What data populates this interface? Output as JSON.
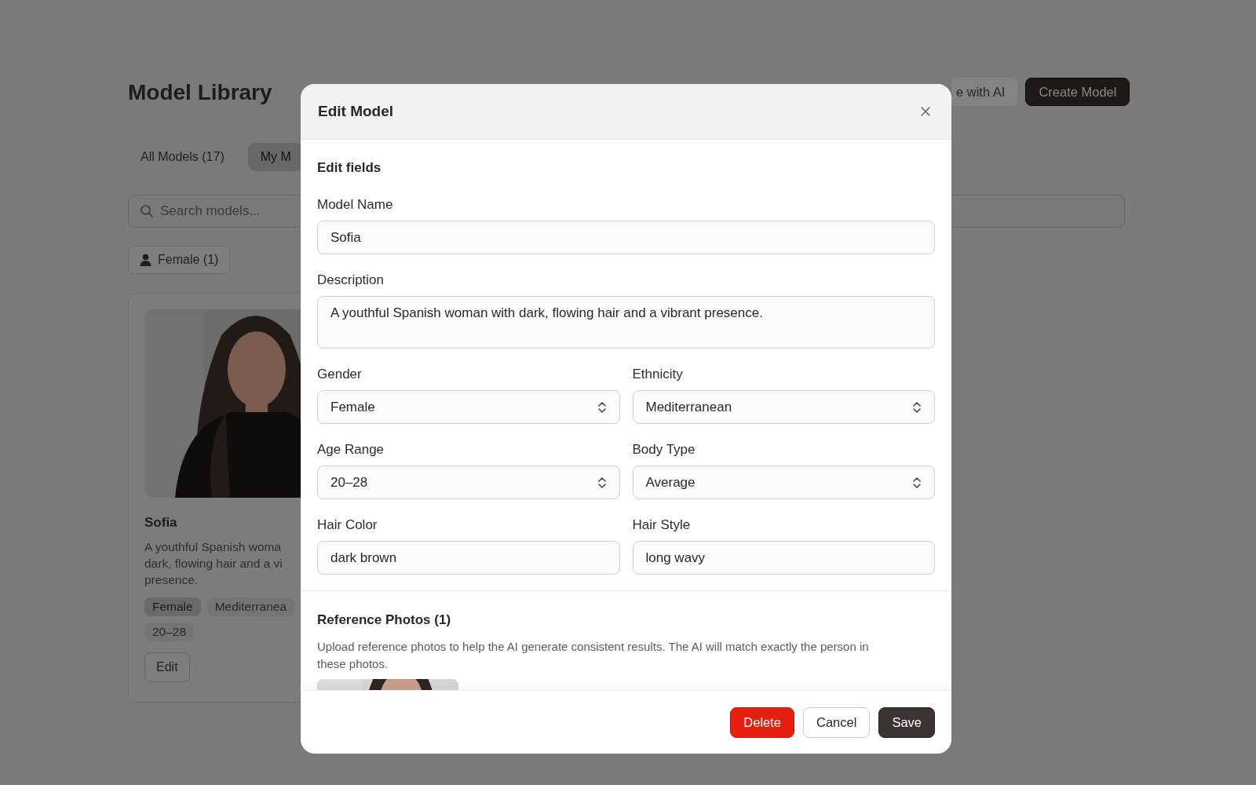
{
  "page": {
    "title": "Model Library",
    "header_buttons": [
      {
        "label": "e with AI",
        "kind": "secondary"
      },
      {
        "label": "Create Model",
        "kind": "primary"
      }
    ],
    "tabs": [
      {
        "label": "All Models (17)",
        "selected": false
      },
      {
        "label": "My M",
        "selected": true
      }
    ],
    "search": {
      "placeholder": "Search models..."
    },
    "filters": [
      {
        "label": "Female (1)"
      }
    ],
    "cards": [
      {
        "name": "Sofia",
        "description_lines": [
          "A youthful Spanish woma",
          "dark, flowing hair and a vi",
          "presence."
        ],
        "tags": [
          {
            "label": "Female",
            "selected": true
          },
          {
            "label": "Mediterranea",
            "selected": false
          },
          {
            "label": "20–28",
            "selected": false
          }
        ],
        "edit_button": "Edit"
      }
    ]
  },
  "modal": {
    "title": "Edit Model",
    "section": "Edit fields",
    "rows": [
      [
        {
          "label": "Model Name",
          "kind": "text",
          "value": "Sofia"
        }
      ],
      [
        {
          "label": "Description",
          "kind": "textarea",
          "value": "A youthful Spanish woman with dark, flowing hair and a vibrant presence."
        }
      ],
      [
        {
          "label": "Gender",
          "kind": "select",
          "value": "Female"
        },
        {
          "label": "Ethnicity",
          "kind": "select",
          "value": "Mediterranean"
        }
      ],
      [
        {
          "label": "Age Range",
          "kind": "select",
          "value": "20–28"
        },
        {
          "label": "Body Type",
          "kind": "select",
          "value": "Average"
        }
      ],
      [
        {
          "label": "Hair Color",
          "kind": "text",
          "value": "dark brown"
        },
        {
          "label": "Hair Style",
          "kind": "text",
          "value": "long wavy"
        }
      ]
    ],
    "reference": {
      "title": "Reference Photos (1)",
      "help": "Upload reference photos to help the AI generate consistent results. The AI will match exactly the person in these photos."
    },
    "buttons": [
      {
        "label": "Delete",
        "kind": "danger"
      },
      {
        "label": "Cancel",
        "kind": "secondary"
      },
      {
        "label": "Save",
        "kind": "primary"
      }
    ]
  }
}
